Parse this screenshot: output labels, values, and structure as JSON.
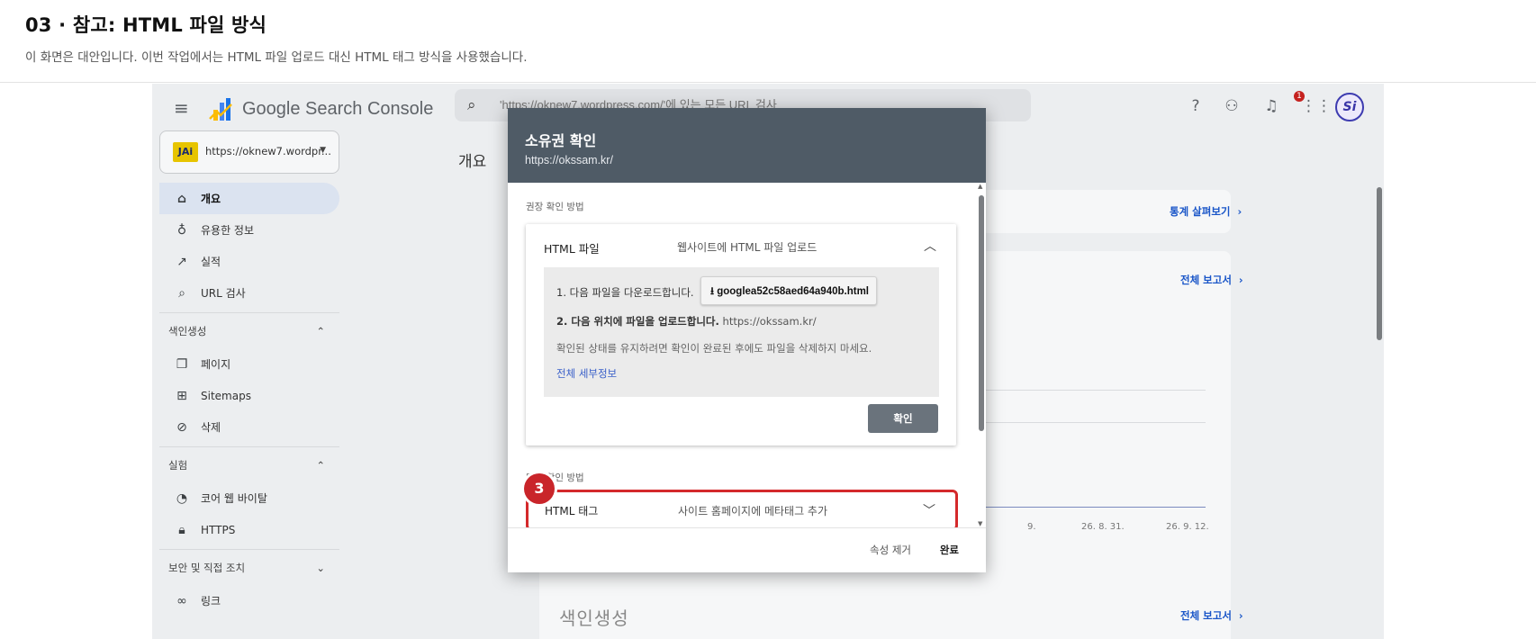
{
  "page": {
    "title": "03 · 참고: HTML 파일 방식",
    "subtitle": "이 화면은 대안입니다. 이번 작업에서는 HTML 파일 업로드 대신 HTML 태그 방식을 사용했습니다."
  },
  "app": {
    "name": "Google Search Console",
    "search_placeholder": "'https://oknew7.wordpress.com/'에 있는 모든 URL 검사",
    "notification_count": "1",
    "avatar_initials": "Si"
  },
  "property": {
    "logo_text": "JAi",
    "url": "https://oknew7.wordpr..."
  },
  "sidebar": {
    "items": [
      {
        "icon": "home-icon",
        "label": "개요"
      },
      {
        "icon": "lightbulb-icon",
        "label": "유용한 정보"
      },
      {
        "icon": "trending-icon",
        "label": "실적"
      },
      {
        "icon": "search-icon",
        "label": "URL 검사"
      }
    ],
    "section_index": "색인생성",
    "index_items": [
      {
        "icon": "pages-icon",
        "label": "페이지"
      },
      {
        "icon": "sitemap-icon",
        "label": "Sitemaps"
      },
      {
        "icon": "hidden-icon",
        "label": "삭제"
      }
    ],
    "section_experience": "실험",
    "experience_items": [
      {
        "icon": "gauge-icon",
        "label": "코어 웹 바이탈"
      },
      {
        "icon": "lock-icon",
        "label": "HTTPS"
      }
    ],
    "section_security": "보안 및 직접 조치",
    "link_item": "링크"
  },
  "main": {
    "overview_title": "개요",
    "stats_link": "통계 살펴보기",
    "report_link": "전체 보고서",
    "report_link2": "전체 보고서",
    "axis_ticks": [
      "9.",
      "26. 8. 31.",
      "26. 9. 12."
    ],
    "indexing_title": "색인생성"
  },
  "dialog": {
    "title": "소유권 확인",
    "url": "https://okssam.kr/",
    "recommended_label": "권장 확인 방법",
    "method": {
      "name": "HTML 파일",
      "description": "웹사이트에 HTML 파일 업로드",
      "step1_text": "1. 다음 파일을 다운로드합니다.",
      "download_file": "googlea52c58aed64a940b.html",
      "step2_bold": "2. 다음 위치에 파일을 업로드합니다.",
      "step2_url": "https://okssam.kr/",
      "keep_note": "확인된 상태를 유지하려면 확인이 완료된 후에도 파일을 삭제하지 마세요.",
      "details_link": "전체 세부정보",
      "confirm_button": "확인"
    },
    "other_label": "다른 확인 방법",
    "tag_method": {
      "name": "HTML 태그",
      "description": "사이트 홈페이지에 메타태그 추가"
    },
    "step_badge": "3",
    "remove_property": "속성 제거",
    "done": "완료"
  }
}
